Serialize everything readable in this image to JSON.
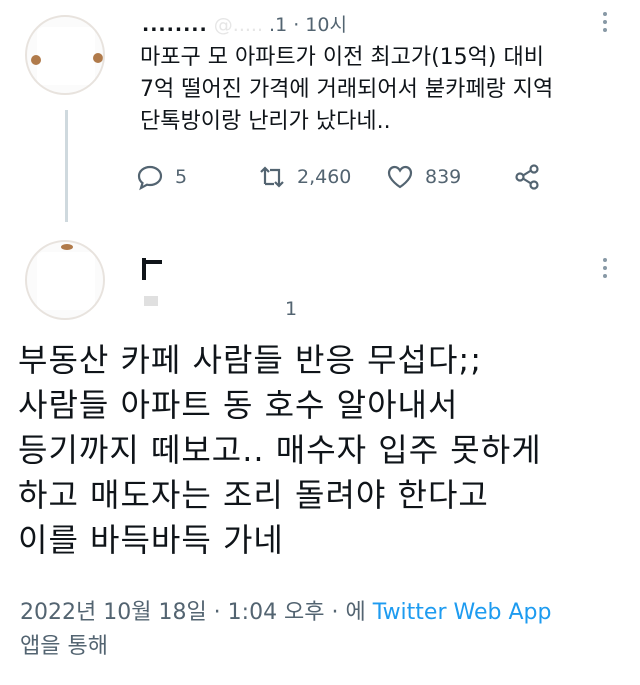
{
  "tweet1": {
    "handle": "........",
    "handle_ghost": "@.....",
    "meta_tail": ".1 · 10시",
    "lines": [
      "마포구 모 아파트가 이전 최고가(15억) 대비",
      "7억 떨어진 가격에 거래되어서 붇카페랑 지역",
      "단톡방이랑 난리가 났다네.."
    ],
    "actions": {
      "reply_icon": "reply-icon",
      "reply_count": "5",
      "retweet_icon": "retweet-icon",
      "retweet_count": "2,460",
      "like_icon": "heart-icon",
      "like_count": "839",
      "share_icon": "share-icon"
    }
  },
  "tweet2": {
    "count_fragment": "1",
    "lines": [
      "부동산 카페 사람들 반응 무섭다;;",
      "사람들 아파트 동 호수 알아내서",
      "등기까지 떼보고.. 매수자 입주 못하게",
      "하고 매도자는 조리 돌려야 한다고",
      "이를 바득바득 가네"
    ],
    "timestamp_prefix": "2022년 10월 18일 · 1:04 오후 · 에 ",
    "source": "Twitter Web App",
    "suffix": "앱을 통해"
  },
  "colors": {
    "text": "#0f1419",
    "muted": "#536471",
    "link": "#1d9bf0",
    "thread_line": "#cfd9de"
  }
}
